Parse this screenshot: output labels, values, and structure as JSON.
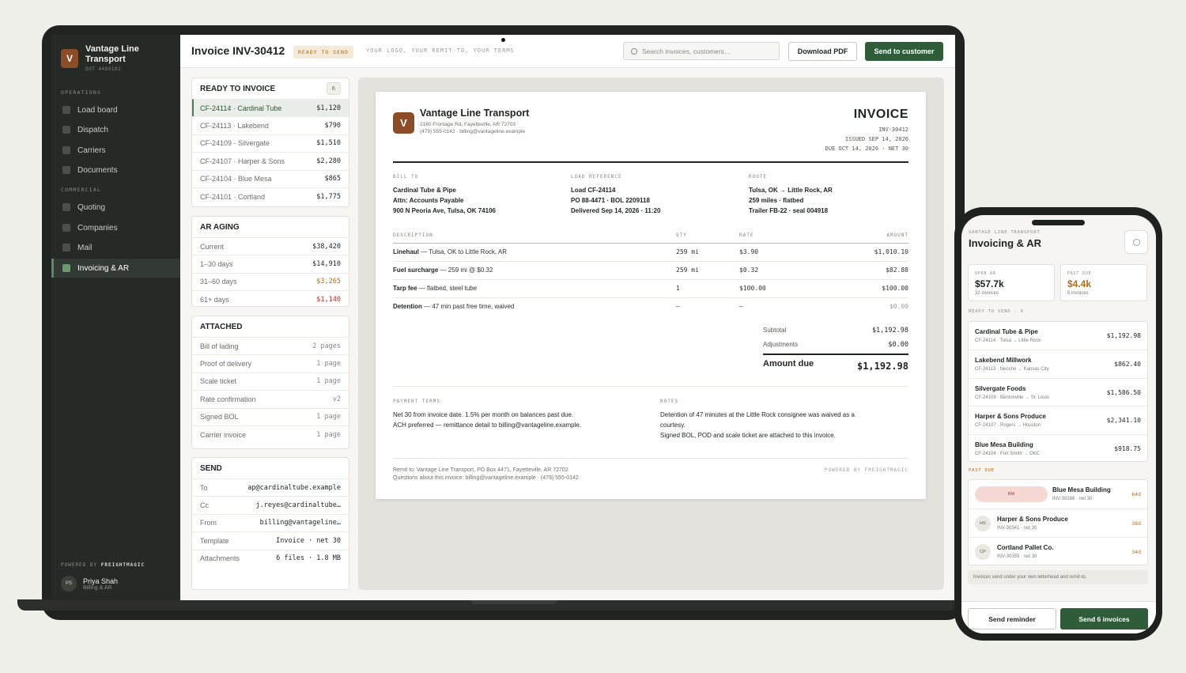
{
  "sidebar": {
    "brand_initial": "V",
    "brand_name": "Vantage Line Transport",
    "brand_dot": "DOT 4480182",
    "section_operations": "OPERATIONS",
    "section_commercial": "COMMERCIAL",
    "items": [
      "Load board",
      "Dispatch",
      "Carriers",
      "Documents",
      "Quoting",
      "Companies",
      "Mail",
      "Invoicing & AR"
    ],
    "powered_prefix": "POWERED BY",
    "powered_brand": "FREIGHTMAGIC",
    "user_initials": "PS",
    "user_name": "Priya Shah",
    "user_role": "Billing & AR"
  },
  "header": {
    "title": "Invoice INV-30412",
    "status": "READY TO SEND",
    "tagline": "YOUR LOGO, YOUR REMIT-TO, YOUR TERMS",
    "search_placeholder": "Search invoices, customers…",
    "download_label": "Download PDF",
    "send_label": "Send to customer"
  },
  "ready_to_invoice": {
    "title": "READY TO INVOICE",
    "count": "6",
    "rows": [
      {
        "label": "CF-24114 · Cardinal Tube",
        "value": "$1,120"
      },
      {
        "label": "CF-24113 · Lakebend",
        "value": "$790"
      },
      {
        "label": "CF-24109 · Silvergate",
        "value": "$1,510"
      },
      {
        "label": "CF-24107 · Harper & Sons",
        "value": "$2,280"
      },
      {
        "label": "CF-24104 · Blue Mesa",
        "value": "$865"
      },
      {
        "label": "CF-24101 · Cortland",
        "value": "$1,775"
      }
    ]
  },
  "ar_aging": {
    "title": "AR AGING",
    "rows": [
      {
        "label": "Current",
        "value": "$38,420"
      },
      {
        "label": "1–30 days",
        "value": "$14,910"
      },
      {
        "label": "31–60 days",
        "value": "$3,265"
      },
      {
        "label": "61+ days",
        "value": "$1,140"
      }
    ]
  },
  "attached": {
    "title": "ATTACHED",
    "rows": [
      {
        "label": "Bill of lading",
        "value": "2 pages"
      },
      {
        "label": "Proof of delivery",
        "value": "1 page"
      },
      {
        "label": "Scale ticket",
        "value": "1 page"
      },
      {
        "label": "Rate confirmation",
        "value": "v2"
      },
      {
        "label": "Signed BOL",
        "value": "1 page"
      },
      {
        "label": "Carrier invoice",
        "value": "1 page"
      }
    ]
  },
  "send": {
    "title": "SEND",
    "rows": [
      {
        "label": "To",
        "value": "ap@cardinaltube.example"
      },
      {
        "label": "Cc",
        "value": "j.reyes@cardinaltube…"
      },
      {
        "label": "From",
        "value": "billing@vantageline…"
      },
      {
        "label": "Template",
        "value": "Invoice · net 30"
      },
      {
        "label": "Attachments",
        "value": "6 files · 1.8 MB"
      }
    ]
  },
  "invoice": {
    "logo_initial": "V",
    "company": "Vantage Line Transport",
    "address": "2180 Frontage Rd, Fayetteville, AR 72703",
    "contact": "(479) 555-0142 · billing@vantageline.example",
    "title": "INVOICE",
    "number": "INV-30412",
    "issued": "ISSUED SEP 14, 2026",
    "due": "DUE OCT 14, 2026 · NET 30",
    "bill_to": {
      "heading": "BILL TO",
      "lines": [
        "Cardinal Tube & Pipe",
        "Attn: Accounts Payable",
        "900 N Peoria Ave, Tulsa, OK 74106"
      ]
    },
    "load_ref": {
      "heading": "LOAD REFERENCE",
      "lines": [
        "Load CF-24114",
        "PO 88-4471 · BOL 2209118",
        "Delivered Sep 14, 2026 · 11:20"
      ]
    },
    "route": {
      "heading": "ROUTE",
      "lines": [
        "Tulsa, OK → Little Rock, AR",
        "259 miles · flatbed",
        "Trailer FB-22 · seal 004918"
      ]
    },
    "columns": [
      "DESCRIPTION",
      "QTY",
      "RATE",
      "AMOUNT"
    ],
    "line_items": [
      {
        "name": "Linehaul",
        "desc": " — Tulsa, OK to Little Rock, AR",
        "qty": "259 mi",
        "rate": "$3.90",
        "amount": "$1,010.10"
      },
      {
        "name": "Fuel surcharge",
        "desc": " — 259 mi @ $0.32",
        "qty": "259 mi",
        "rate": "$0.32",
        "amount": "$82.88"
      },
      {
        "name": "Tarp fee",
        "desc": " — flatbed, steel tube",
        "qty": "1",
        "rate": "$100.00",
        "amount": "$100.00"
      },
      {
        "name": "Detention",
        "desc": " — 47 min past free time, waived",
        "qty": "—",
        "rate": "—",
        "amount": "$0.00"
      }
    ],
    "subtotal_label": "Subtotal",
    "subtotal": "$1,192.98",
    "adjustments_label": "Adjustments",
    "adjustments": "$0.00",
    "amount_due_label": "Amount due",
    "amount_due": "$1,192.98",
    "payment_terms_heading": "PAYMENT TERMS",
    "payment_terms": [
      "Net 30 from invoice date. 1.5% per month on balances past due.",
      "ACH preferred — remittance detail to billing@vantageline.example."
    ],
    "notes_heading": "NOTES",
    "notes": [
      "Detention of 47 minutes at the Little Rock consignee was waived as a",
      "courtesy.",
      "Signed BOL, POD and scale ticket are attached to this invoice."
    ],
    "remit": "Remit to: Vantage Line Transport, PO Box 4471, Fayetteville, AR 72702",
    "questions": "Questions about this invoice: billing@vantageline.example · (479) 555-0142",
    "powered": "POWERED BY FREIGHTMAGIC"
  },
  "phone": {
    "brand": "VANTAGE LINE TRANSPORT",
    "title": "Invoicing & AR",
    "open_ar_label": "OPEN AR",
    "open_ar": "$57.7k",
    "open_ar_sub": "32 invoices",
    "past_due_label": "PAST DUE",
    "past_due": "$4.4k",
    "past_due_sub": "5 invoices",
    "ready_label": "READY TO SEND · 6",
    "ready": [
      {
        "name": "Cardinal Tube & Pipe",
        "sub": "CF-24114 · Tulsa → Little Rock",
        "amount": "$1,192.98"
      },
      {
        "name": "Lakebend Millwork",
        "sub": "CF-24113 · Neosho → Kansas City",
        "amount": "$862.40"
      },
      {
        "name": "Silvergate Foods",
        "sub": "CF-24109 · Bentonville → St. Louis",
        "amount": "$1,586.50"
      },
      {
        "name": "Harper & Sons Produce",
        "sub": "CF-24107 · Rogers → Houston",
        "amount": "$2,341.10"
      },
      {
        "name": "Blue Mesa Building",
        "sub": "CF-24104 · Fort Smith → OKC",
        "amount": "$918.75"
      }
    ],
    "past_due_section": "PAST DUE",
    "past_due_items": [
      {
        "initials": "BM",
        "name": "Blue Mesa Building",
        "sub": "INV-30288 · net 30",
        "age": "64d"
      },
      {
        "initials": "HS",
        "name": "Harper & Sons Produce",
        "sub": "INV-30341 · net 30",
        "age": "38d"
      },
      {
        "initials": "CP",
        "name": "Cortland Pallet Co.",
        "sub": "INV-30355 · net 30",
        "age": "34d"
      }
    ],
    "note": "Invoices send under your own letterhead and remit-to.",
    "reminder_label": "Send reminder",
    "send_all_label": "Send 6 invoices"
  },
  "colors": {
    "accent": "#2f5d3a",
    "brand": "#8b4d28",
    "warn": "#b46b1c",
    "danger": "#b1332a"
  }
}
